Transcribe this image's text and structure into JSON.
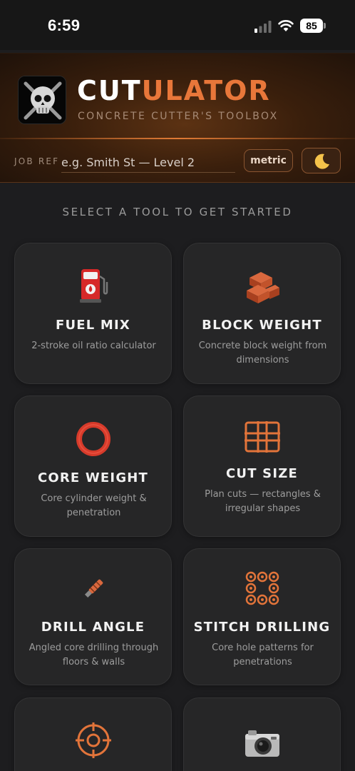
{
  "status_bar": {
    "time": "6:59",
    "battery": "85"
  },
  "header": {
    "title_part1": "CUT",
    "title_part2": "ULATOR",
    "subtitle": "CONCRETE CUTTER'S TOOLBOX",
    "job_ref_label": "JOB REF",
    "job_ref_placeholder": "e.g. Smith St — Level 2",
    "units_label": "metric",
    "theme_icon": "moon-icon"
  },
  "main": {
    "heading": "SELECT A TOOL TO GET STARTED",
    "tools": [
      {
        "title": "FUEL MIX",
        "desc": "2-stroke oil ratio calculator",
        "icon": "fuel-pump-icon"
      },
      {
        "title": "BLOCK WEIGHT",
        "desc": "Concrete block weight from dimensions",
        "icon": "bricks-icon"
      },
      {
        "title": "CORE WEIGHT",
        "desc": "Core cylinder weight & penetration",
        "icon": "core-ring-icon"
      },
      {
        "title": "CUT SIZE",
        "desc": "Plan cuts — rectangles & irregular shapes",
        "icon": "cut-grid-icon"
      },
      {
        "title": "DRILL ANGLE",
        "desc": "Angled core drilling through floors & walls",
        "icon": "drill-bit-icon"
      },
      {
        "title": "STITCH DRILLING",
        "desc": "Core hole patterns for penetrations",
        "icon": "stitch-pattern-icon"
      },
      {
        "title": "",
        "desc": "",
        "icon": "crosshair-icon"
      },
      {
        "title": "",
        "desc": "",
        "icon": "camera-icon"
      }
    ]
  },
  "colors": {
    "accent": "#e8773a",
    "background": "#1d1d1f",
    "card": "#262627"
  }
}
